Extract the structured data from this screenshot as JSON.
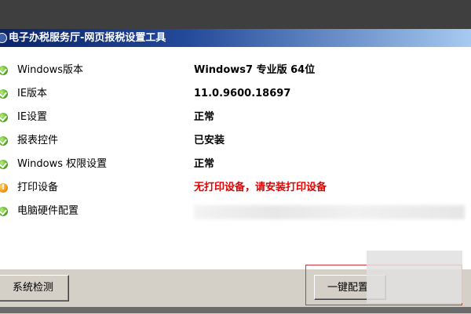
{
  "window": {
    "title": "电子办税服务厅-网页报税设置工具"
  },
  "checks": [
    {
      "label": "Windows版本",
      "value": "Windows7 专业版 64位",
      "status": "ok"
    },
    {
      "label": "IE版本",
      "value": "11.0.9600.18697",
      "status": "ok"
    },
    {
      "label": "IE设置",
      "value": "正常",
      "status": "ok"
    },
    {
      "label": "报表控件",
      "value": "已安装",
      "status": "ok"
    },
    {
      "label": "Windows 权限设置",
      "value": "正常",
      "status": "ok"
    },
    {
      "label": "打印设备",
      "value": "无打印设备，请安装打印设备",
      "status": "warning"
    },
    {
      "label": "电脑硬件配置",
      "value": "",
      "status": "ok"
    }
  ],
  "buttons": {
    "system_check": "系统检测",
    "one_click_config": "一键配置"
  },
  "colors": {
    "ok": "#4aa01c",
    "warning": "#f08a00",
    "error_text": "#e00000",
    "highlight_border": "#d03a3a"
  },
  "icons": {
    "ok": "check-circle-icon",
    "warning": "exclamation-circle-icon"
  }
}
